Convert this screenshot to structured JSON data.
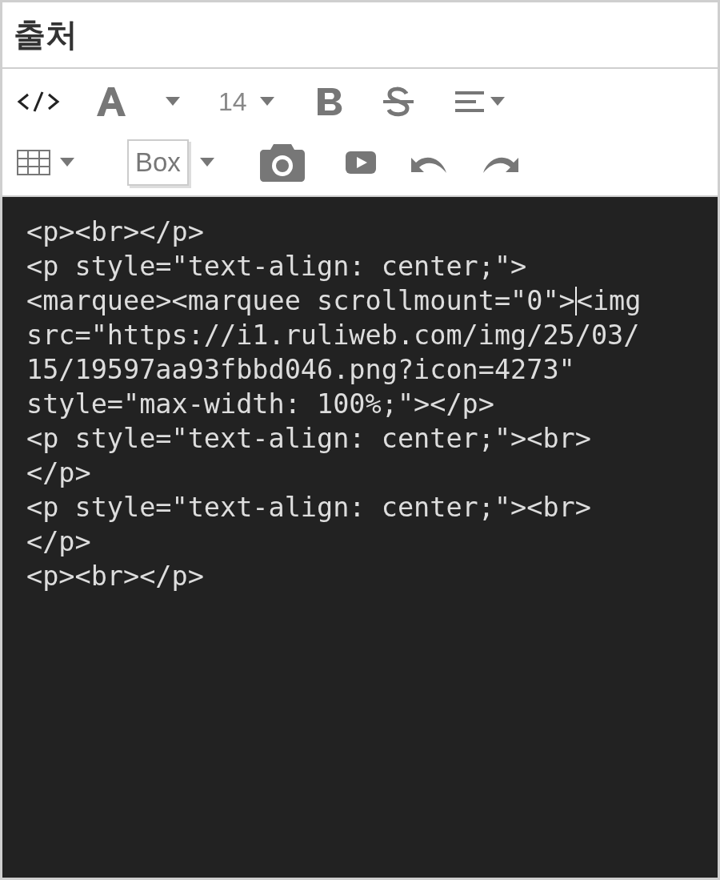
{
  "title": "출처",
  "toolbar_rows": [
    [
      {
        "kind": "code"
      },
      {
        "kind": "font"
      },
      {
        "kind": "caret"
      },
      {
        "kind": "size",
        "label": "14"
      },
      {
        "kind": "caret"
      },
      {
        "kind": "bold"
      },
      {
        "kind": "strike"
      },
      {
        "kind": "align"
      },
      {
        "kind": "caret"
      }
    ],
    [
      {
        "kind": "table"
      },
      {
        "kind": "caret"
      },
      {
        "kind": "box",
        "label": "Box"
      },
      {
        "kind": "caret"
      },
      {
        "kind": "camera"
      },
      {
        "kind": "video"
      },
      {
        "kind": "undo"
      },
      {
        "kind": "redo"
      }
    ]
  ],
  "editor": {
    "lines": [
      {
        "segments": [
          "<p><br></p>"
        ]
      },
      {
        "segments": [
          "<p style=\"text-align: center;\">"
        ]
      },
      {
        "segments": [
          "<marquee><marquee scrollmount=\"0\">",
          "<img"
        ]
      },
      {
        "segments": [
          "src=\"https://i1.ruliweb.com/img/25/03/"
        ]
      },
      {
        "segments": [
          "15/19597aa93fbbd046.png?icon=4273\""
        ]
      },
      {
        "segments": [
          "style=\"max-width: 100%;\"></p>"
        ]
      },
      {
        "segments": [
          "<p style=\"text-align: center;\"><br>"
        ]
      },
      {
        "segments": [
          "</p>"
        ]
      },
      {
        "segments": [
          "<p style=\"text-align: center;\"><br>"
        ]
      },
      {
        "segments": [
          "</p>"
        ]
      },
      {
        "segments": [
          "<p><br></p>"
        ]
      }
    ]
  }
}
